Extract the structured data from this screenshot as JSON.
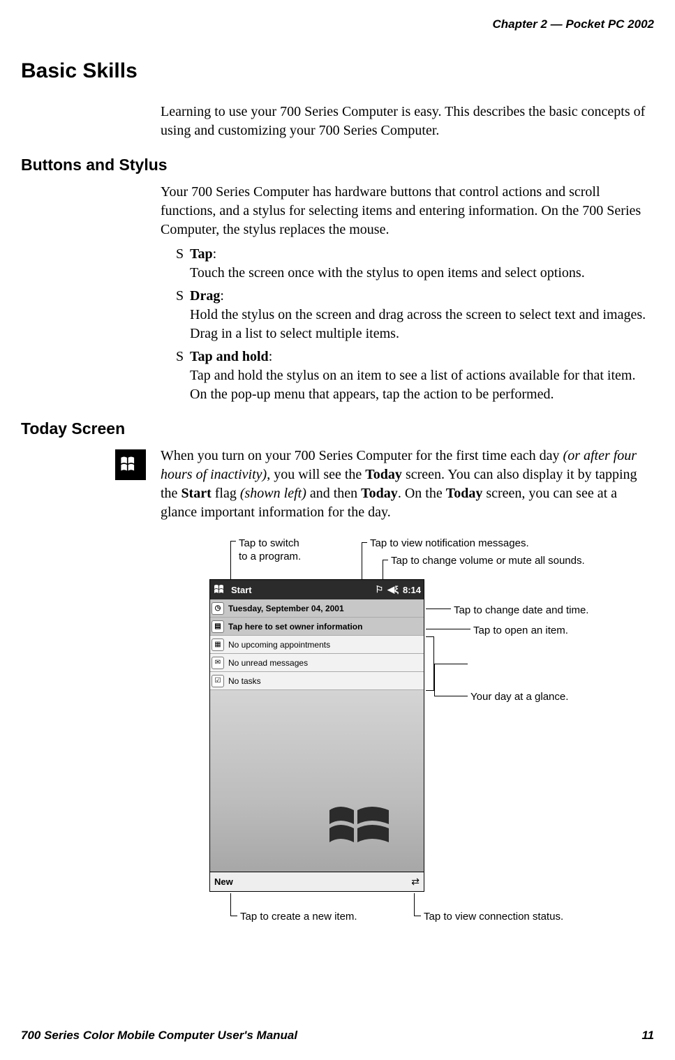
{
  "header": {
    "chapter": "Chapter  2",
    "sep": "  —  ",
    "product": "Pocket PC 2002"
  },
  "footer": {
    "manual": "700 Series Color Mobile Computer User's Manual",
    "page": "11"
  },
  "h1": "Basic Skills",
  "intro": "Learning to use your 700 Series Computer is easy. This describes the basic concepts of using and customizing your 700 Series Computer.",
  "h2_buttons": "Buttons and Stylus",
  "buttons_intro": "Your 700 Series Computer has hardware buttons that control actions and scroll functions, and a stylus for selecting items and entering information. On the 700 Series Computer, the stylus replaces the mouse.",
  "bullets": [
    {
      "dot": "S",
      "label": "Tap",
      "colon": ":",
      "body": "Touch the screen once with the stylus to open items and select options."
    },
    {
      "dot": "S",
      "label": "Drag",
      "colon": ":",
      "body": "Hold the stylus on the screen and drag across the screen to select text and images. Drag in a list to select multiple items."
    },
    {
      "dot": "S",
      "label": "Tap and hold",
      "colon": ":",
      "body": "Tap and hold the stylus on an item to see a list of actions available for that item. On the pop-up menu that appears, tap the action to be performed."
    }
  ],
  "h2_today": "Today Screen",
  "today_para": {
    "t1": "When you turn on your 700 Series Computer for the first time each day ",
    "em1": "(or after four hours of inactivity)",
    "t2": ", you will see the ",
    "b1": "Today",
    "t3": " screen. You can also display it by tapping the ",
    "b2": "Start",
    "t4": " flag ",
    "em2": "(shown left)",
    "t5": " and then ",
    "b3": "Today",
    "t6": ". On the ",
    "b4": "Today",
    "t7": " screen, you can see at a glance important information for the day."
  },
  "device": {
    "start": "Start",
    "time": "8:14",
    "date": "Tuesday, September 04, 2001",
    "owner": "Tap here to set owner information",
    "appts": "No upcoming appointments",
    "msgs": "No unread messages",
    "tasks": "No tasks",
    "new": "New"
  },
  "callouts": {
    "c1a": "Tap to switch",
    "c1b": "to a program.",
    "c2": "Tap to view notification messages.",
    "c3": "Tap to change volume or mute all sounds.",
    "c4": "Tap to change date and time.",
    "c5": "Tap to open an item.",
    "c6": "Your day at a glance.",
    "c7": "Tap to create a new item.",
    "c8": "Tap to view connection status."
  }
}
